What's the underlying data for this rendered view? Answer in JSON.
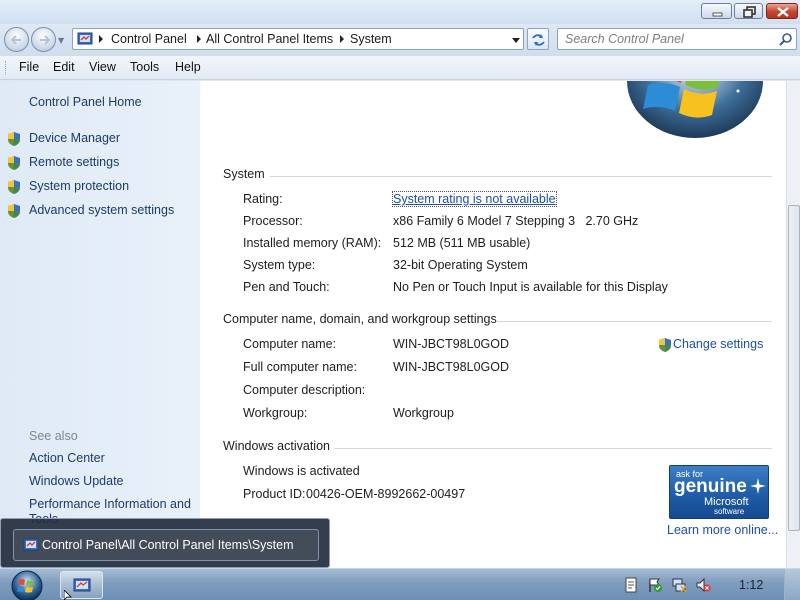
{
  "window": {
    "breadcrumb": [
      "Control Panel",
      "All Control Panel Items",
      "System"
    ],
    "search_placeholder": "Search Control Panel"
  },
  "menu": [
    "File",
    "Edit",
    "View",
    "Tools",
    "Help"
  ],
  "sidebar": {
    "home": "Control Panel Home",
    "tasks": [
      "Device Manager",
      "Remote settings",
      "System protection",
      "Advanced system settings"
    ],
    "see_also_title": "See also",
    "see_also": [
      "Action Center",
      "Windows Update",
      "Performance Information and Tools"
    ]
  },
  "system": {
    "title": "System",
    "rows": [
      {
        "label": "Rating:",
        "value": "System rating is not available"
      },
      {
        "label": "Processor:",
        "value": "x86 Family 6 Model 7 Stepping 3   2.70 GHz"
      },
      {
        "label": "Installed memory (RAM):",
        "value": "512 MB (511 MB usable)"
      },
      {
        "label": "System type:",
        "value": "32-bit Operating System"
      },
      {
        "label": "Pen and Touch:",
        "value": "No Pen or Touch Input is available for this Display"
      }
    ]
  },
  "computer": {
    "title": "Computer name, domain, and workgroup settings",
    "change_settings": "Change settings",
    "rows": [
      {
        "label": "Computer name:",
        "value": "WIN-JBCT98L0GOD"
      },
      {
        "label": "Full computer name:",
        "value": "WIN-JBCT98L0GOD"
      },
      {
        "label": "Computer description:",
        "value": ""
      },
      {
        "label": "Workgroup:",
        "value": "Workgroup"
      }
    ]
  },
  "activation": {
    "title": "Windows activation",
    "status": "Windows is activated",
    "product_id_label": "Product ID:",
    "product_id": "00426-OEM-8992662-00497",
    "badge_ask": "ask for",
    "badge_genuine": "genuine",
    "badge_microsoft": "Microsoft",
    "badge_software": "software",
    "learn_more": "Learn more online..."
  },
  "thumbnail": {
    "title": "Control Panel\\All Control Panel Items\\System"
  },
  "taskbar": {
    "clock": "1:12"
  },
  "colors": {
    "link": "#1e4fa8",
    "sidebar_bg": "#dfeaf6",
    "taskbar": "#7e9cbd",
    "close_button": "#c4452f"
  }
}
